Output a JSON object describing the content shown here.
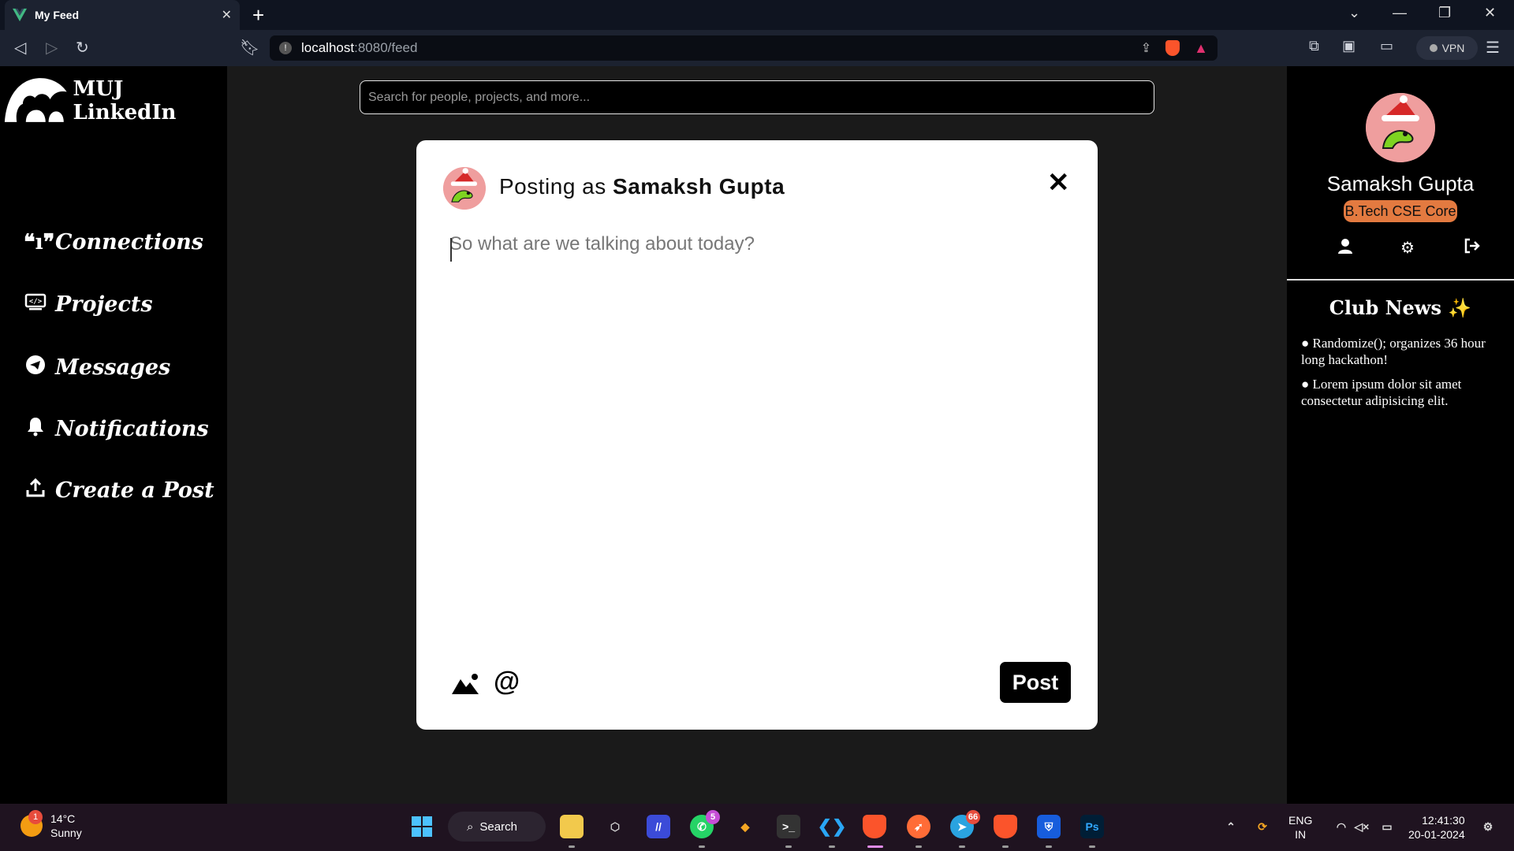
{
  "browser": {
    "tab_title": "My Feed",
    "url_host": "localhost",
    "url_path": ":8080/feed",
    "vpn_label": "VPN"
  },
  "sidebar": {
    "brand": "MUJ LinkedIn",
    "items": [
      {
        "label": "Connections",
        "icon": "antenna-icon"
      },
      {
        "label": "Projects",
        "icon": "projects-icon"
      },
      {
        "label": "Messages",
        "icon": "telegram-icon"
      },
      {
        "label": "Notifications",
        "icon": "bell-icon"
      },
      {
        "label": "Create a Post",
        "icon": "upload-icon"
      }
    ]
  },
  "search": {
    "placeholder": "Search for people, projects, and more..."
  },
  "profile": {
    "name": "Samaksh Gupta",
    "badge": "B.Tech CSE Core"
  },
  "club_news": {
    "title": "Club News ✨",
    "items": [
      "Randomize(); organizes 36 hour long hackathon!",
      "Lorem ipsum dolor sit amet consectetur adipisicing elit."
    ]
  },
  "modal": {
    "posting_prefix": "Posting as",
    "posting_name": "Samaksh Gupta",
    "composer_placeholder": "So what are we talking about today?",
    "post_label": "Post"
  },
  "taskbar": {
    "temp": "14°C",
    "condition": "Sunny",
    "weather_badge": "1",
    "search_label": "Search",
    "whatsapp_badge": "5",
    "telegram_badge": "66",
    "lang_1": "ENG",
    "lang_2": "IN",
    "time": "12:41:30",
    "date": "20-01-2024"
  },
  "colors": {
    "accent_badge": "#e37a40",
    "page_bg": "#1a1a1a",
    "sidebar_bg": "#000000"
  }
}
